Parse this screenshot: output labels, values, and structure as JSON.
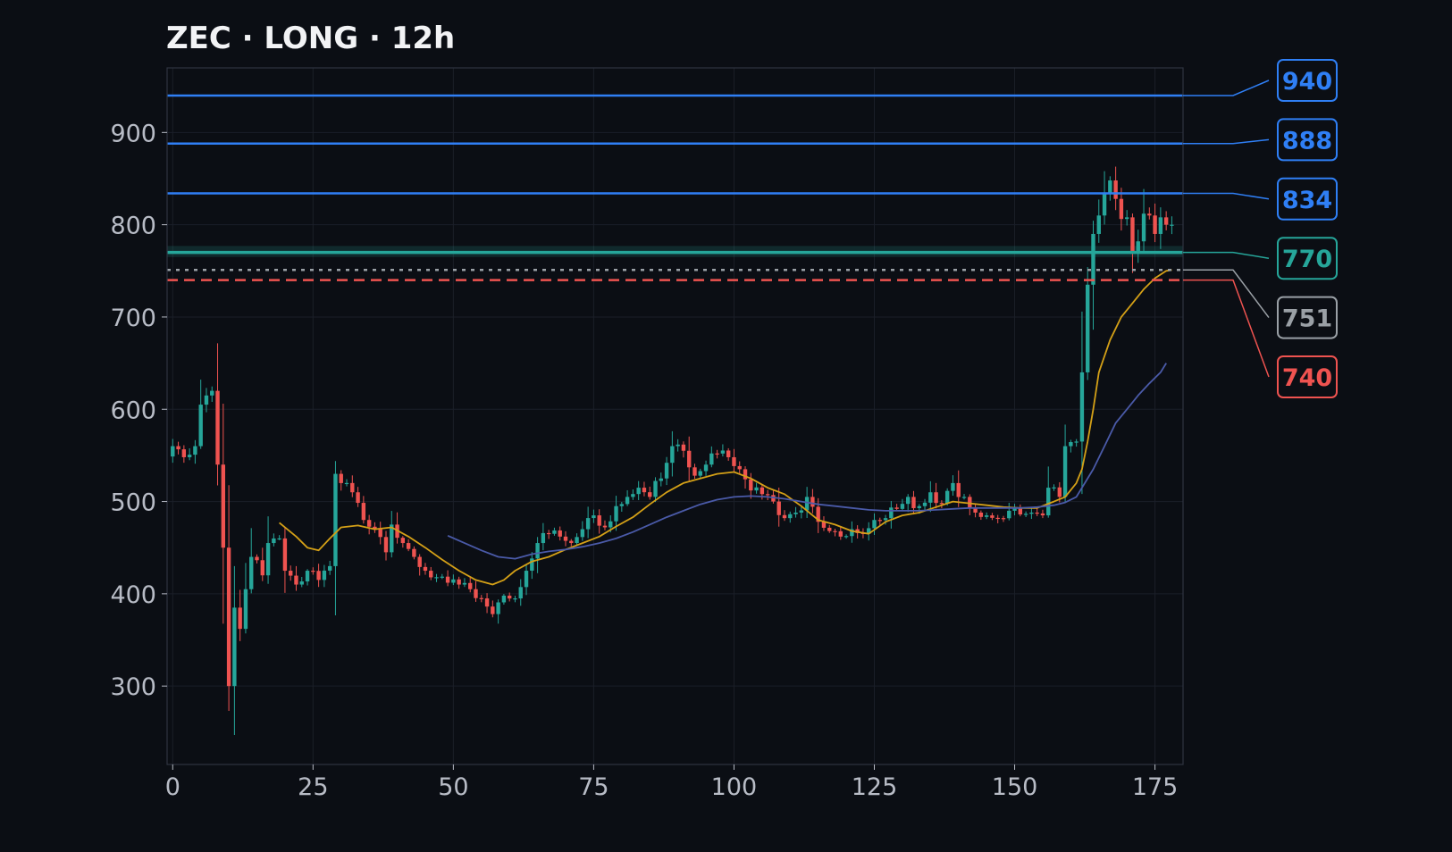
{
  "title": "ZEC · LONG · 12h",
  "colors": {
    "background": "#0b0e14",
    "frame": "#2f3440",
    "grid": "#1b1f28",
    "axis_text": "#b8bcc6",
    "title": "#f2f3f5",
    "up": "#26a69a",
    "down": "#ef5350",
    "ma_fast": "#d4a017",
    "ma_slow": "#4a5aa8",
    "target": "#2f7ff5",
    "entry_zone": "#26a69a",
    "entry_line": "#9aa0a6",
    "stop": "#ef5350"
  },
  "chart_data": {
    "type": "candlestick",
    "title": "ZEC · LONG · 12h",
    "xlim": [
      -1,
      180
    ],
    "ylim": [
      215,
      970
    ],
    "x_ticks": [
      0,
      25,
      50,
      75,
      100,
      125,
      150,
      175
    ],
    "y_ticks": [
      300,
      400,
      500,
      600,
      700,
      800,
      900
    ],
    "grid": true,
    "key_close": [
      [
        0,
        560
      ],
      [
        2,
        548
      ],
      [
        4,
        560
      ],
      [
        5,
        605
      ],
      [
        7,
        620
      ],
      [
        8,
        540
      ],
      [
        9,
        450
      ],
      [
        10,
        300
      ],
      [
        11,
        385
      ],
      [
        12,
        362
      ],
      [
        13,
        405
      ],
      [
        14,
        440
      ],
      [
        16,
        420
      ],
      [
        17,
        455
      ],
      [
        19,
        460
      ],
      [
        20,
        425
      ],
      [
        22,
        410
      ],
      [
        24,
        425
      ],
      [
        26,
        415
      ],
      [
        28,
        430
      ],
      [
        29,
        530
      ],
      [
        30,
        520
      ],
      [
        32,
        510
      ],
      [
        34,
        480
      ],
      [
        36,
        470
      ],
      [
        38,
        445
      ],
      [
        39,
        475
      ],
      [
        41,
        455
      ],
      [
        43,
        440
      ],
      [
        45,
        425
      ],
      [
        47,
        418
      ],
      [
        49,
        412
      ],
      [
        51,
        410
      ],
      [
        53,
        405
      ],
      [
        55,
        395
      ],
      [
        57,
        378
      ],
      [
        59,
        398
      ],
      [
        61,
        395
      ],
      [
        63,
        425
      ],
      [
        65,
        455
      ],
      [
        67,
        465
      ],
      [
        69,
        462
      ],
      [
        71,
        455
      ],
      [
        73,
        470
      ],
      [
        75,
        485
      ],
      [
        77,
        472
      ],
      [
        79,
        495
      ],
      [
        81,
        505
      ],
      [
        83,
        515
      ],
      [
        85,
        505
      ],
      [
        87,
        525
      ],
      [
        89,
        560
      ],
      [
        91,
        555
      ],
      [
        93,
        528
      ],
      [
        95,
        540
      ],
      [
        97,
        552
      ],
      [
        99,
        548
      ],
      [
        101,
        535
      ],
      [
        103,
        512
      ],
      [
        105,
        508
      ],
      [
        107,
        500
      ],
      [
        109,
        482
      ],
      [
        111,
        488
      ],
      [
        113,
        505
      ],
      [
        115,
        478
      ],
      [
        117,
        468
      ],
      [
        119,
        462
      ],
      [
        121,
        470
      ],
      [
        123,
        465
      ],
      [
        125,
        480
      ],
      [
        127,
        482
      ],
      [
        129,
        492
      ],
      [
        131,
        505
      ],
      [
        133,
        495
      ],
      [
        135,
        510
      ],
      [
        137,
        498
      ],
      [
        139,
        520
      ],
      [
        141,
        505
      ],
      [
        143,
        488
      ],
      [
        145,
        485
      ],
      [
        147,
        482
      ],
      [
        149,
        490
      ],
      [
        151,
        486
      ],
      [
        153,
        488
      ],
      [
        155,
        485
      ],
      [
        156,
        515
      ],
      [
        158,
        505
      ],
      [
        159,
        560
      ],
      [
        161,
        565
      ],
      [
        162,
        640
      ],
      [
        163,
        735
      ],
      [
        164,
        790
      ],
      [
        165,
        810
      ],
      [
        167,
        848
      ],
      [
        168,
        828
      ],
      [
        170,
        808
      ],
      [
        171,
        770
      ],
      [
        172,
        782
      ],
      [
        173,
        812
      ],
      [
        174,
        810
      ],
      [
        175,
        790
      ],
      [
        176,
        808
      ],
      [
        177,
        800
      ],
      [
        178,
        800
      ]
    ],
    "ma_fast_points": [
      [
        19,
        477
      ],
      [
        22,
        462
      ],
      [
        24,
        450
      ],
      [
        26,
        447
      ],
      [
        28,
        460
      ],
      [
        30,
        472
      ],
      [
        33,
        474
      ],
      [
        36,
        470
      ],
      [
        39,
        472
      ],
      [
        42,
        462
      ],
      [
        45,
        450
      ],
      [
        48,
        437
      ],
      [
        51,
        425
      ],
      [
        54,
        415
      ],
      [
        57,
        410
      ],
      [
        59,
        415
      ],
      [
        61,
        425
      ],
      [
        64,
        435
      ],
      [
        67,
        440
      ],
      [
        70,
        448
      ],
      [
        73,
        455
      ],
      [
        76,
        462
      ],
      [
        79,
        473
      ],
      [
        82,
        483
      ],
      [
        85,
        497
      ],
      [
        88,
        510
      ],
      [
        91,
        520
      ],
      [
        94,
        525
      ],
      [
        97,
        530
      ],
      [
        100,
        532
      ],
      [
        103,
        525
      ],
      [
        106,
        515
      ],
      [
        109,
        508
      ],
      [
        112,
        495
      ],
      [
        115,
        480
      ],
      [
        118,
        475
      ],
      [
        121,
        468
      ],
      [
        124,
        465
      ],
      [
        127,
        478
      ],
      [
        130,
        485
      ],
      [
        133,
        488
      ],
      [
        136,
        494
      ],
      [
        139,
        500
      ],
      [
        142,
        498
      ],
      [
        145,
        496
      ],
      [
        148,
        494
      ],
      [
        151,
        493
      ],
      [
        154,
        493
      ],
      [
        157,
        500
      ],
      [
        159,
        505
      ],
      [
        161,
        520
      ],
      [
        162,
        535
      ],
      [
        163,
        565
      ],
      [
        164,
        600
      ],
      [
        165,
        640
      ],
      [
        167,
        675
      ],
      [
        169,
        700
      ],
      [
        171,
        715
      ],
      [
        173,
        730
      ],
      [
        175,
        742
      ],
      [
        177,
        750
      ],
      [
        178,
        751
      ]
    ],
    "ma_slow_points": [
      [
        49,
        463
      ],
      [
        52,
        455
      ],
      [
        55,
        447
      ],
      [
        58,
        440
      ],
      [
        61,
        438
      ],
      [
        64,
        443
      ],
      [
        67,
        446
      ],
      [
        70,
        448
      ],
      [
        73,
        451
      ],
      [
        76,
        455
      ],
      [
        79,
        460
      ],
      [
        82,
        467
      ],
      [
        85,
        475
      ],
      [
        88,
        483
      ],
      [
        91,
        490
      ],
      [
        94,
        497
      ],
      [
        97,
        502
      ],
      [
        100,
        505
      ],
      [
        103,
        506
      ],
      [
        106,
        505
      ],
      [
        109,
        503
      ],
      [
        112,
        500
      ],
      [
        115,
        497
      ],
      [
        118,
        495
      ],
      [
        121,
        493
      ],
      [
        124,
        491
      ],
      [
        127,
        490
      ],
      [
        130,
        490
      ],
      [
        133,
        490
      ],
      [
        136,
        491
      ],
      [
        139,
        492
      ],
      [
        142,
        493
      ],
      [
        145,
        493
      ],
      [
        148,
        493
      ],
      [
        151,
        493
      ],
      [
        154,
        494
      ],
      [
        157,
        496
      ],
      [
        159,
        499
      ],
      [
        161,
        505
      ],
      [
        162,
        515
      ],
      [
        164,
        535
      ],
      [
        166,
        560
      ],
      [
        168,
        585
      ],
      [
        170,
        600
      ],
      [
        172,
        615
      ],
      [
        174,
        628
      ],
      [
        176,
        640
      ],
      [
        177,
        650
      ]
    ],
    "levels": [
      {
        "label": "940",
        "value": 940,
        "kind": "target"
      },
      {
        "label": "888",
        "value": 888,
        "kind": "target"
      },
      {
        "label": "834",
        "value": 834,
        "kind": "target"
      },
      {
        "label": "770",
        "value": 770,
        "kind": "entry_zone",
        "zone": [
          765,
          777
        ]
      },
      {
        "label": "751",
        "value": 751,
        "kind": "entry"
      },
      {
        "label": "740",
        "value": 740,
        "kind": "stop"
      }
    ]
  }
}
